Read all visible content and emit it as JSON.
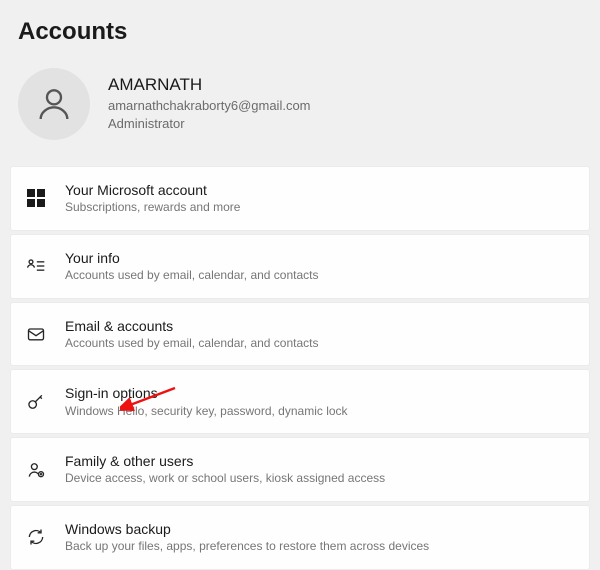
{
  "header": {
    "title": "Accounts"
  },
  "profile": {
    "name": "AMARNATH",
    "email": "amarnathchakraborty6@gmail.com",
    "role": "Administrator"
  },
  "rows": [
    {
      "icon": "microsoft-icon",
      "title": "Your Microsoft account",
      "sub": "Subscriptions, rewards and more"
    },
    {
      "icon": "your-info-icon",
      "title": "Your info",
      "sub": "Accounts used by email, calendar, and contacts"
    },
    {
      "icon": "email-icon",
      "title": "Email & accounts",
      "sub": "Accounts used by email, calendar, and contacts"
    },
    {
      "icon": "key-icon",
      "title": "Sign-in options",
      "sub": "Windows Hello, security key, password, dynamic lock"
    },
    {
      "icon": "family-icon",
      "title": "Family & other users",
      "sub": "Device access, work or school users, kiosk assigned access"
    },
    {
      "icon": "backup-icon",
      "title": "Windows backup",
      "sub": "Back up your files, apps, preferences to restore them across devices"
    }
  ]
}
